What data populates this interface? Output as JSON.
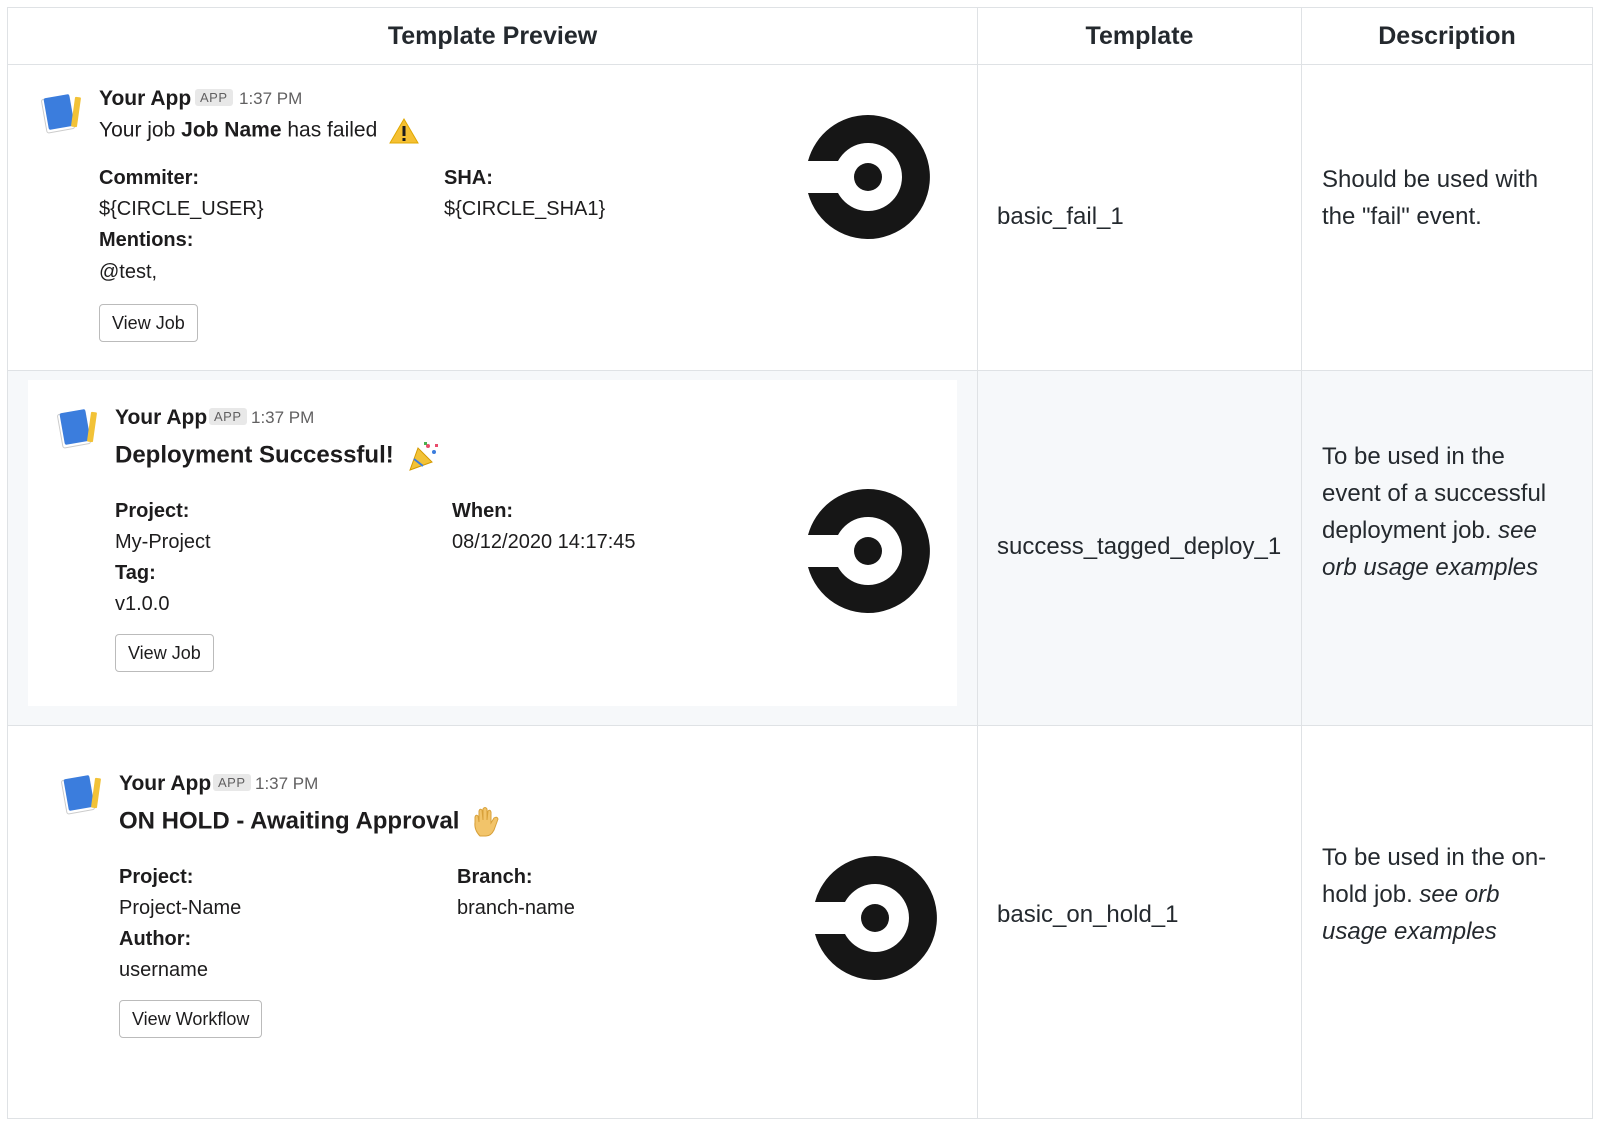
{
  "headers": {
    "preview": "Template Preview",
    "template": "Template",
    "description": "Description"
  },
  "rows": [
    {
      "app_name": "Your App",
      "app_badge": "APP",
      "time": "1:37 PM",
      "message_prefix": "Your job",
      "message_bold": "Job Name",
      "message_suffix": "has failed",
      "emoji_icon": "warning-icon",
      "fields": [
        {
          "label": "Commiter:",
          "value": "${CIRCLE_USER}"
        },
        {
          "label": "SHA:",
          "value": "${CIRCLE_SHA1}"
        },
        {
          "label": "Mentions:",
          "value": "@test,"
        }
      ],
      "button": "View Job",
      "template": "basic_fail_1",
      "description_plain": "Should be used with the \"fail\" event.",
      "description_italic": ""
    },
    {
      "app_name": "Your App",
      "app_badge": "APP",
      "time": "1:37 PM",
      "heading": "Deployment Successful!",
      "emoji_icon": "party-popper-icon",
      "fields": [
        {
          "label": "Project:",
          "value": "My-Project"
        },
        {
          "label": "When:",
          "value": "08/12/2020 14:17:45"
        },
        {
          "label": "Tag:",
          "value": "v1.0.0"
        }
      ],
      "button": "View Job",
      "template": "success_tagged_deploy_1",
      "description_plain": "To be used in the event of a successful deployment job.",
      "description_italic": "see orb usage examples"
    },
    {
      "app_name": "Your App",
      "app_badge": "APP",
      "time": "1:37 PM",
      "heading": "ON HOLD - Awaiting Approval",
      "emoji_icon": "raised-hand-icon",
      "fields": [
        {
          "label": "Project:",
          "value": "Project-Name"
        },
        {
          "label": "Branch:",
          "value": "branch-name"
        },
        {
          "label": "Author:",
          "value": "username"
        }
      ],
      "button": "View Workflow",
      "template": "basic_on_hold_1",
      "description_plain": "To be used in the on-hold job.",
      "description_italic": "see orb usage examples"
    }
  ],
  "colors": {
    "border": "#dfe2e5",
    "alt_row": "#f6f8fa",
    "logo": "#161616",
    "avatar_blue": "#3b7ddd",
    "avatar_yellow": "#f2c237"
  }
}
